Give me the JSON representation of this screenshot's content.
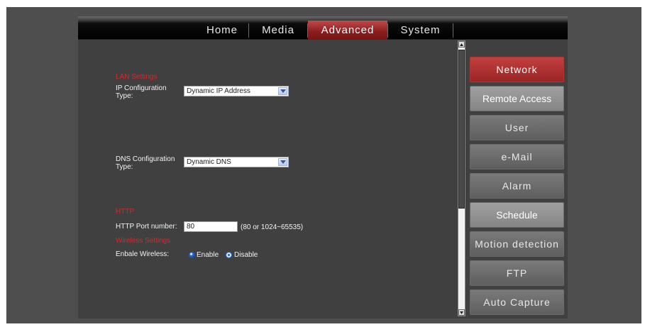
{
  "nav": {
    "tabs": [
      {
        "label": "Home",
        "active": false
      },
      {
        "label": "Media",
        "active": false
      },
      {
        "label": "Advanced",
        "active": true
      },
      {
        "label": "System",
        "active": false
      }
    ]
  },
  "lan": {
    "section_title": "LAN Settings",
    "ip_label_line1": "IP Configuration",
    "ip_label_line2": "Type:",
    "ip_value": "Dynamic IP Address",
    "dns_label_line1": "DNS Configuration",
    "dns_label_line2": "Type:",
    "dns_value": "Dynamic DNS"
  },
  "http": {
    "section_title": "HTTP",
    "port_label": "HTTP Port number:",
    "port_value": "80",
    "port_hint": "(80 or 1024~65535)"
  },
  "wireless": {
    "section_title": "Wireless Settings",
    "label": "Enbale Wireless:",
    "enable_label": "Enable",
    "disable_label": "Disable",
    "selected": "Enable"
  },
  "sidebar": {
    "items": [
      {
        "label": "Network",
        "active": true
      },
      {
        "label": "Remote Access",
        "active": false
      },
      {
        "label": "User",
        "active": false
      },
      {
        "label": "e-Mail",
        "active": false
      },
      {
        "label": "Alarm",
        "active": false
      },
      {
        "label": "Schedule",
        "active": false
      },
      {
        "label": "Motion detection",
        "active": false
      },
      {
        "label": "FTP",
        "active": false
      },
      {
        "label": "Auto Capture",
        "active": false
      }
    ]
  },
  "colors": {
    "accent_red": "#a32a2a",
    "section_red": "#d42a2a",
    "background": "#404040"
  }
}
